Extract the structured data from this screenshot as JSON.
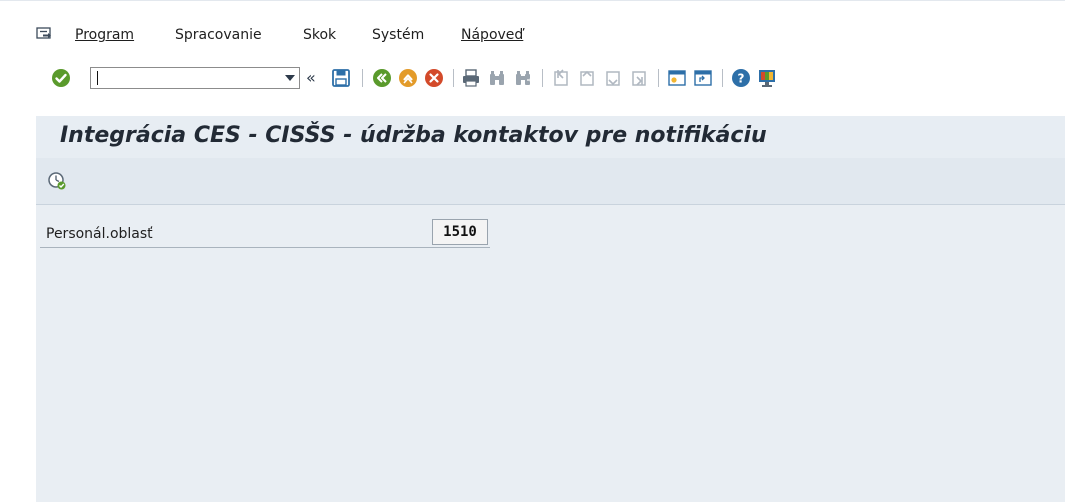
{
  "menu": {
    "items": [
      {
        "label": "Program"
      },
      {
        "label": "Spracovanie"
      },
      {
        "label": "Skok"
      },
      {
        "label": "Systém"
      },
      {
        "label": "Nápoveď"
      }
    ]
  },
  "toolbar": {
    "command_field": {
      "value": "",
      "placeholder": ""
    },
    "icons": [
      "enter-icon",
      "command-dropdown-icon",
      "collapse-icon",
      "save-icon",
      "back-icon",
      "exit-icon",
      "cancel-icon",
      "print-icon",
      "find-icon",
      "find-next-icon",
      "first-page-icon",
      "previous-page-icon",
      "next-page-icon",
      "last-page-icon",
      "new-session-icon",
      "shortcut-icon",
      "help-icon",
      "customize-layout-icon"
    ]
  },
  "screen": {
    "title": "Integrácia CES - CISŠS - údržba kontaktov pre notifikáciu"
  },
  "form": {
    "fields": [
      {
        "label": "Personál.oblasť",
        "value": "1510"
      }
    ]
  },
  "colors": {
    "title_bg": "#e7edf3",
    "app_toolbar_bg": "#e1e8ef",
    "content_bg": "#e9eef3",
    "enter_green": "#5a9a2c",
    "cancel_red": "#d34a2a",
    "exit_orange": "#e39b2a"
  }
}
